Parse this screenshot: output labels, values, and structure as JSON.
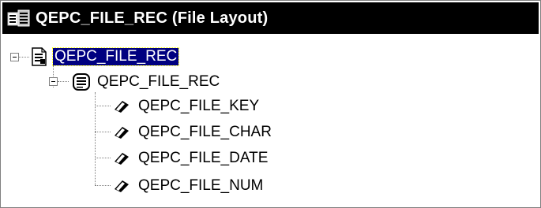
{
  "window": {
    "title": "QEPC_FILE_REC (File Layout)"
  },
  "tree": {
    "root": {
      "label": "QEPC_FILE_REC",
      "icon": "file-layout-icon",
      "selected": true
    },
    "record": {
      "label": "QEPC_FILE_REC",
      "icon": "record-icon"
    },
    "fields": [
      {
        "label": "QEPC_FILE_KEY",
        "icon": "field-icon"
      },
      {
        "label": "QEPC_FILE_CHAR",
        "icon": "field-icon"
      },
      {
        "label": "QEPC_FILE_DATE",
        "icon": "field-icon"
      },
      {
        "label": "QEPC_FILE_NUM",
        "icon": "field-icon"
      }
    ]
  },
  "colors": {
    "titlebar": "#000000",
    "selection": "#000080"
  }
}
